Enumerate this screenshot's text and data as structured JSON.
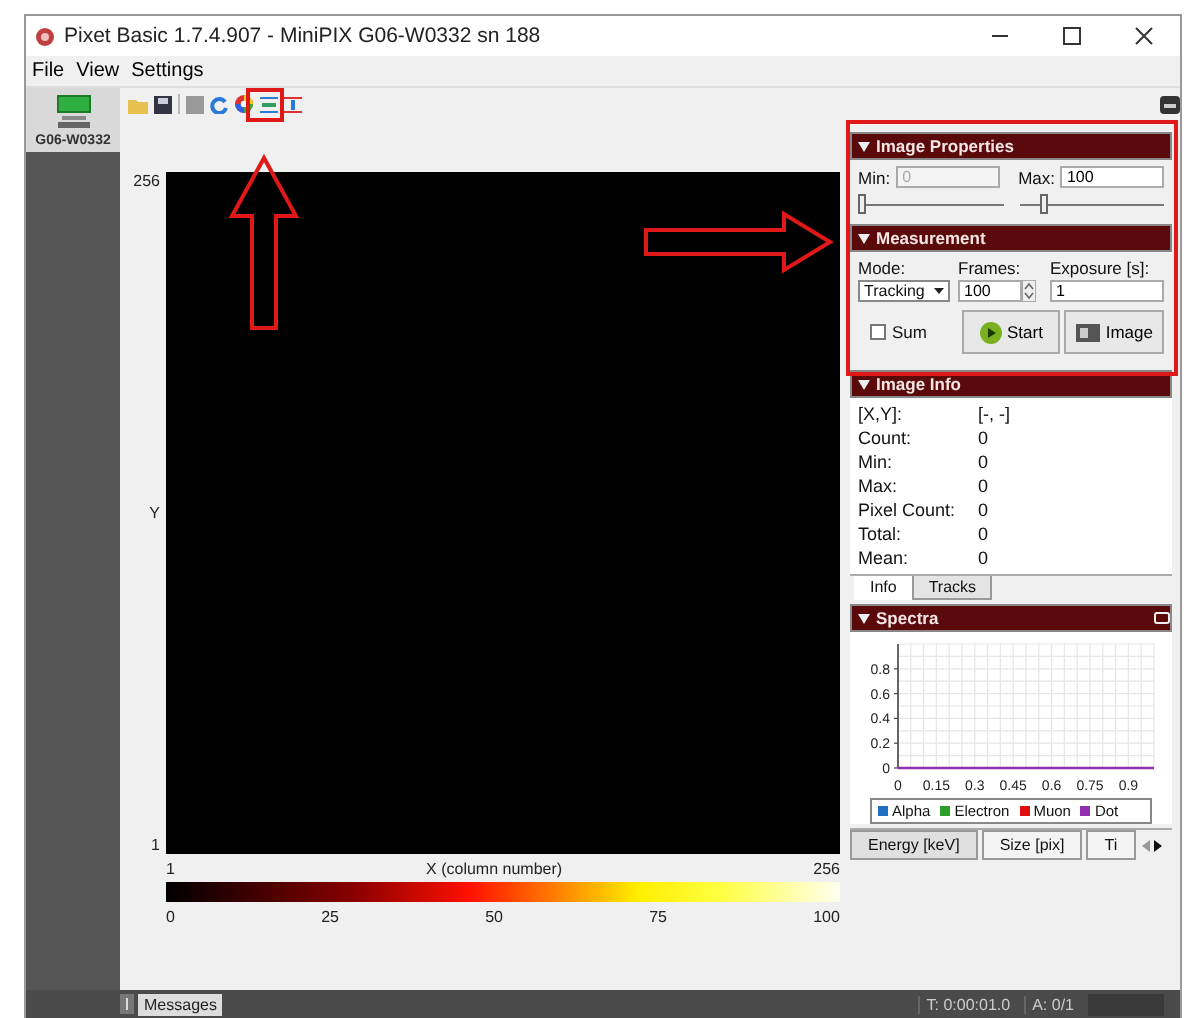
{
  "window": {
    "title": "Pixet Basic 1.7.4.907 - MiniPIX G06-W0332 sn 188"
  },
  "menu": [
    {
      "label": "File"
    },
    {
      "label": "View"
    },
    {
      "label": "Settings"
    }
  ],
  "device": {
    "label": "G06-W0332",
    "selected": true
  },
  "image": {
    "y_max": "256",
    "y_label": "Y",
    "y_min": "1",
    "x_min": "1",
    "x_label": "X (column number)",
    "x_max": "256"
  },
  "colorbar": {
    "ticks": [
      "0",
      "25",
      "50",
      "75",
      "100"
    ]
  },
  "image_properties": {
    "title": "Image Properties",
    "min_label": "Min:",
    "min_value": "0",
    "min_disabled": true,
    "max_label": "Max:",
    "max_value": "100",
    "min_slider": {
      "level": 0.0
    },
    "max_slider": {
      "level": 0.15
    }
  },
  "measurement": {
    "title": "Measurement",
    "mode_label": "Mode:",
    "mode": "Tracking",
    "frames_label": "Frames:",
    "frames": "100",
    "exposure_label": "Exposure [s]:",
    "exposure": "1",
    "sum": {
      "label": "Sum",
      "checked": false
    },
    "buttons": [
      {
        "label": "Start",
        "kind": "start"
      },
      {
        "label": "Image",
        "kind": "image"
      }
    ]
  },
  "image_info": {
    "title": "Image Info",
    "rows": [
      {
        "label": "[X,Y]:",
        "value": "[-, -]"
      },
      {
        "label": "Count:",
        "value": "0"
      },
      {
        "label": "Min:",
        "value": "0"
      },
      {
        "label": "Max:",
        "value": "0"
      },
      {
        "label": "Pixel Count:",
        "value": "0"
      },
      {
        "label": "Total:",
        "value": "0"
      },
      {
        "label": "Mean:",
        "value": "0"
      }
    ],
    "tabs": [
      {
        "label": "Info",
        "selected": true
      },
      {
        "label": "Tracks",
        "selected": false
      }
    ]
  },
  "spectra": {
    "title": "Spectra",
    "chart_data": {
      "type": "line",
      "grid": true,
      "x": [
        0,
        1
      ],
      "xlim": [
        0,
        1
      ],
      "ylim": [
        0,
        1
      ],
      "xticks": [
        0,
        0.15,
        0.3,
        0.45,
        0.6,
        0.75,
        0.9
      ],
      "yticks": [
        0,
        0.2,
        0.4,
        0.6,
        0.8
      ],
      "series": [
        {
          "name": "Alpha",
          "color": "#1f6fc0",
          "values": [
            null,
            null
          ]
        },
        {
          "name": "Electron",
          "color": "#2aa02a",
          "values": [
            null,
            null
          ]
        },
        {
          "name": "Muon",
          "color": "#e01010",
          "values": [
            null,
            null
          ]
        },
        {
          "name": "Dot",
          "color": "#9030b0",
          "values": [
            0,
            0
          ]
        }
      ]
    },
    "tabs": [
      {
        "label": "Energy [keV]",
        "selected": true
      },
      {
        "label": "Size [pix]",
        "selected": false
      },
      {
        "label": "Ti",
        "selected": false
      }
    ]
  },
  "status": {
    "messages": "Messages",
    "time": "T: 0:00:01.0",
    "acquisitions": "A: 0/1"
  }
}
